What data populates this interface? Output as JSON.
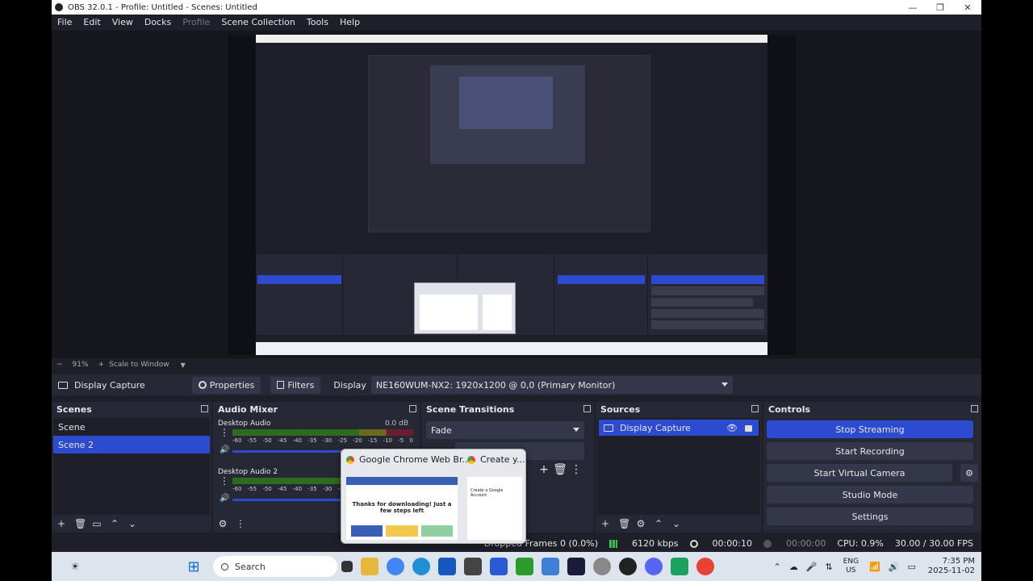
{
  "window": {
    "title": "OBS 32.0.1 - Profile: Untitled - Scenes: Untitled",
    "controls": [
      "—",
      "❐",
      "✕"
    ]
  },
  "menu": [
    "File",
    "Edit",
    "View",
    "Docks",
    "Profile",
    "Scene Collection",
    "Tools",
    "Help"
  ],
  "preview_toolbar": {
    "minus": "−",
    "zoom": "91%",
    "plus": "+",
    "scale": "Scale to Window"
  },
  "source_toolbar": {
    "source_name": "Display Capture",
    "properties": "Properties",
    "filters": "Filters",
    "display_label": "Display",
    "display_value": "NE160WUM-NX2: 1920x1200 @ 0,0 (Primary Monitor)"
  },
  "scenes": {
    "title": "Scenes",
    "items": [
      "Scene",
      "Scene 2"
    ],
    "selected_index": 1
  },
  "audio_mixer": {
    "title": "Audio Mixer",
    "scale": [
      "-60",
      "-55",
      "-50",
      "-45",
      "-40",
      "-35",
      "-30",
      "-25",
      "-20",
      "-15",
      "-10",
      "-5",
      "0"
    ],
    "channels": [
      {
        "name": "Desktop Audio",
        "db": "0.0 dB"
      },
      {
        "name": "Desktop Audio 2",
        "db": ""
      }
    ]
  },
  "scene_transitions": {
    "title": "Scene Transitions",
    "transition": "Fade"
  },
  "sources": {
    "title": "Sources",
    "items": [
      "Display Capture"
    ]
  },
  "controls": {
    "title": "Controls",
    "buttons": [
      "Stop Streaming",
      "Start Recording",
      "Start Virtual Camera",
      "Studio Mode",
      "Settings"
    ]
  },
  "statusbar": {
    "dropped_frames": "Dropped Frames 0 (0.0%)",
    "bitrate": "6120 kbps",
    "stream_time": "00:00:10",
    "rec_time": "00:00:00",
    "cpu": "CPU: 0.9%",
    "fps": "30.00 / 30.00 FPS"
  },
  "popup": {
    "tab1": "Google Chrome Web Br...",
    "tab2": "Create y...",
    "thumb_heading": "Thanks for downloading! Just a few steps left",
    "thumb2_text": "Create a Google Account"
  },
  "taskbar": {
    "search_placeholder": "Search",
    "lang_top": "ENG",
    "lang_bottom": "US",
    "time": "7:35 PM",
    "date": "2025-11-02"
  }
}
